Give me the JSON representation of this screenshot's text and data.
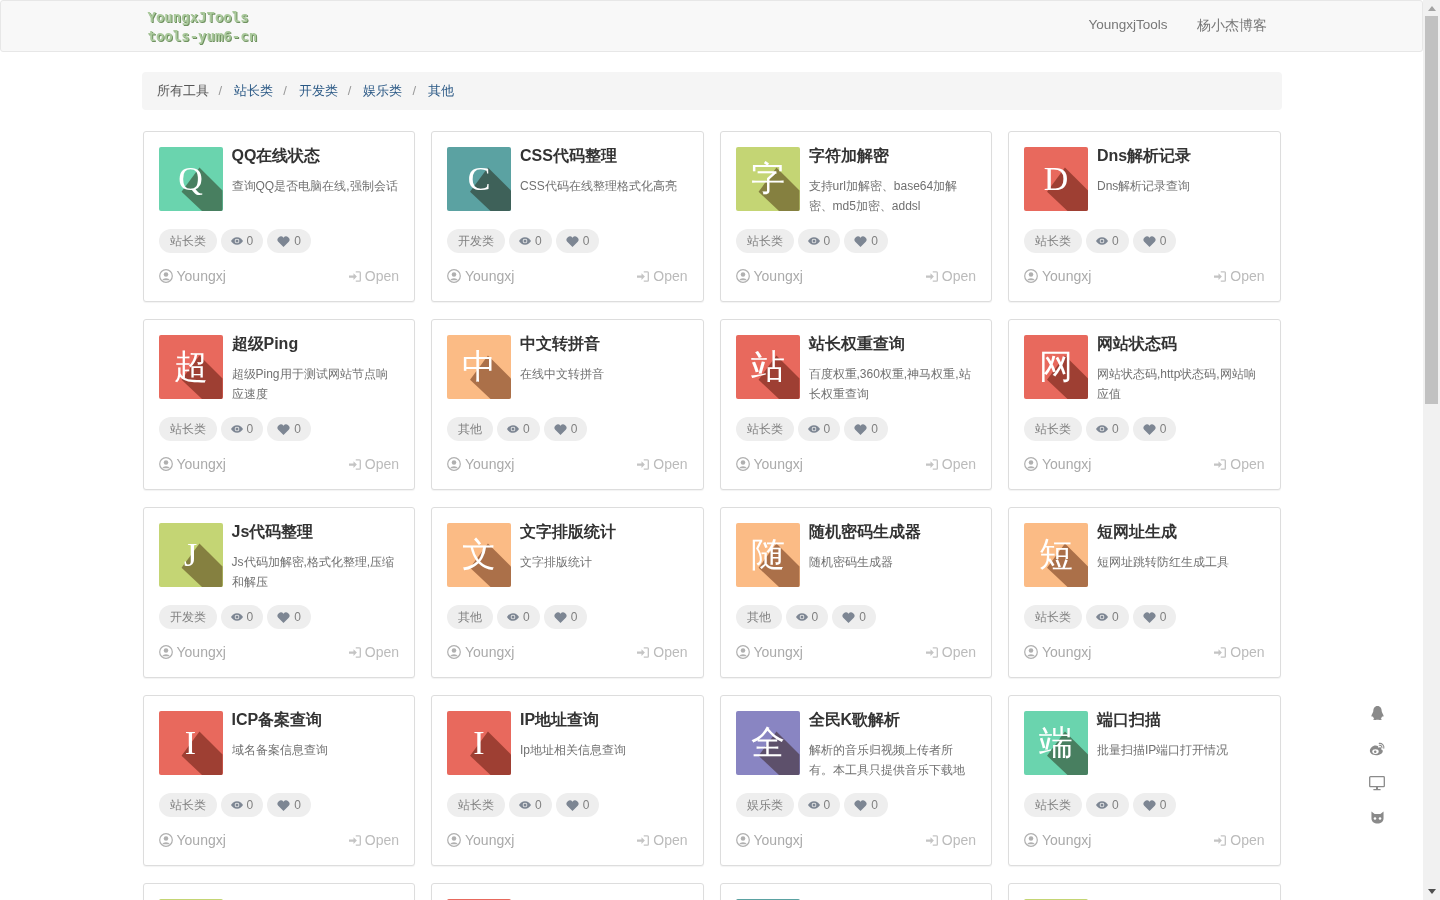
{
  "navbar": {
    "logo": [
      "YoungxJTools",
      "tools-yum6-cn"
    ],
    "links": [
      "YoungxjTools",
      "杨小杰博客"
    ]
  },
  "breadcrumb": [
    {
      "label": "所有工具",
      "selected": true
    },
    {
      "separator": "/",
      "label": "站长类",
      "selected": false
    },
    {
      "separator": "/",
      "label": "开发类",
      "selected": false
    },
    {
      "separator": "/",
      "label": "娱乐类",
      "selected": false
    },
    {
      "separator": "/",
      "label": "其他",
      "selected": false
    }
  ],
  "cards": [
    {
      "letter": "Q",
      "title": "QQ在线状态",
      "description": "查询QQ是否电脑在线,强制会话",
      "category": "站长类",
      "views": "0",
      "likes": "0",
      "author": "Youngxj",
      "action": "Open",
      "color": "#6ad4ae"
    },
    {
      "letter": "C",
      "title": "CSS代码整理",
      "description": "CSS代码在线整理格式化高亮",
      "category": "开发类",
      "views": "0",
      "likes": "0",
      "author": "Youngxj",
      "action": "Open",
      "color": "#5ba2a2"
    },
    {
      "letter": "字",
      "title": "字符加解密",
      "description": "支持url加解密、base64加解密、md5加密、addsl",
      "category": "站长类",
      "views": "0",
      "likes": "0",
      "author": "Youngxj",
      "action": "Open",
      "color": "#c4d574"
    },
    {
      "letter": "D",
      "title": "Dns解析记录",
      "description": "Dns解析记录查询",
      "category": "站长类",
      "views": "0",
      "likes": "0",
      "author": "Youngxj",
      "action": "Open",
      "color": "#e8695d"
    },
    {
      "letter": "超",
      "title": "超级Ping",
      "description": "超级Ping用于测试网站节点响应速度",
      "category": "站长类",
      "views": "0",
      "likes": "0",
      "author": "Youngxj",
      "action": "Open",
      "color": "#e8695d"
    },
    {
      "letter": "中",
      "title": "中文转拼音",
      "description": "在线中文转拼音",
      "category": "其他",
      "views": "0",
      "likes": "0",
      "author": "Youngxj",
      "action": "Open",
      "color": "#fbbb85"
    },
    {
      "letter": "站",
      "title": "站长权重查询",
      "description": "百度权重,360权重,神马权重,站长权重查询",
      "category": "站长类",
      "views": "0",
      "likes": "0",
      "author": "Youngxj",
      "action": "Open",
      "color": "#e8695d"
    },
    {
      "letter": "网",
      "title": "网站状态码",
      "description": "网站状态码,http状态码,网站响应值",
      "category": "站长类",
      "views": "0",
      "likes": "0",
      "author": "Youngxj",
      "action": "Open",
      "color": "#e8695d"
    },
    {
      "letter": "J",
      "title": "Js代码整理",
      "description": "Js代码加解密,格式化整理,压缩和解压",
      "category": "开发类",
      "views": "0",
      "likes": "0",
      "author": "Youngxj",
      "action": "Open",
      "color": "#c4d574"
    },
    {
      "letter": "文",
      "title": "文字排版统计",
      "description": "文字排版统计",
      "category": "其他",
      "views": "0",
      "likes": "0",
      "author": "Youngxj",
      "action": "Open",
      "color": "#fbbb85"
    },
    {
      "letter": "随",
      "title": "随机密码生成器",
      "description": "随机密码生成器",
      "category": "其他",
      "views": "0",
      "likes": "0",
      "author": "Youngxj",
      "action": "Open",
      "color": "#fbbb85"
    },
    {
      "letter": "短",
      "title": "短网址生成",
      "description": "短网址跳转防红生成工具",
      "category": "站长类",
      "views": "0",
      "likes": "0",
      "author": "Youngxj",
      "action": "Open",
      "color": "#fbbb85"
    },
    {
      "letter": "I",
      "title": "ICP备案查询",
      "description": "域名备案信息查询",
      "category": "站长类",
      "views": "0",
      "likes": "0",
      "author": "Youngxj",
      "action": "Open",
      "color": "#e8695d"
    },
    {
      "letter": "I",
      "title": "IP地址查询",
      "description": "Ip地址相关信息查询",
      "category": "站长类",
      "views": "0",
      "likes": "0",
      "author": "Youngxj",
      "action": "Open",
      "color": "#e8695d"
    },
    {
      "letter": "全",
      "title": "全民K歌解析",
      "description": "解析的音乐归视频上传者所有。本工具只提供音乐下载地",
      "category": "娱乐类",
      "views": "0",
      "likes": "0",
      "author": "Youngxj",
      "action": "Open",
      "color": "#8985c2"
    },
    {
      "letter": "端",
      "title": "端口扫描",
      "description": "批量扫描IP端口打开情况",
      "category": "站长类",
      "views": "0",
      "likes": "0",
      "author": "Youngxj",
      "action": "Open",
      "color": "#6ad4ae"
    },
    {
      "color": "#c4d574"
    },
    {
      "color": "#e8695d"
    },
    {
      "color": "#5ba2a2"
    },
    {
      "color": "#c4d574"
    }
  ]
}
